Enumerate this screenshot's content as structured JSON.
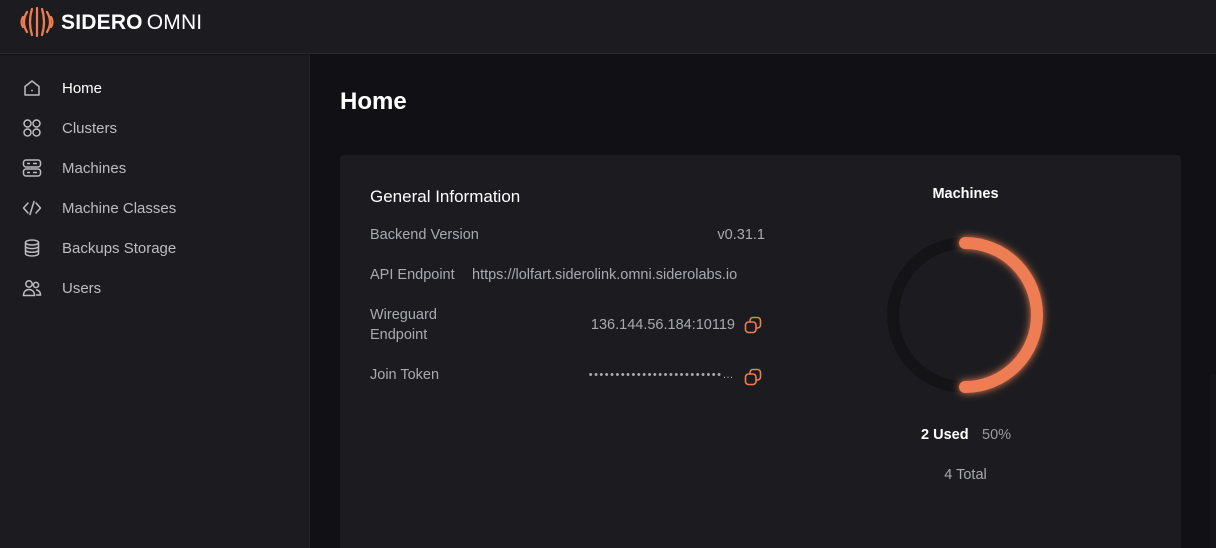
{
  "header": {
    "brand_primary": "SIDERO",
    "brand_secondary": "OMNI",
    "logo_icon": "sidero-logo-icon"
  },
  "sidebar": {
    "items": [
      {
        "label": "Home",
        "icon": "home-icon",
        "active": true
      },
      {
        "label": "Clusters",
        "icon": "grid-icon",
        "active": false
      },
      {
        "label": "Machines",
        "icon": "server-icon",
        "active": false
      },
      {
        "label": "Machine Classes",
        "icon": "code-icon",
        "active": false
      },
      {
        "label": "Backups Storage",
        "icon": "database-icon",
        "active": false
      },
      {
        "label": "Users",
        "icon": "users-icon",
        "active": false
      }
    ]
  },
  "main": {
    "title": "Home",
    "general_info": {
      "title": "General Information",
      "backend_version_label": "Backend Version",
      "backend_version": "v0.31.1",
      "api_endpoint_label": "API Endpoint",
      "api_endpoint": "https://lolfart.siderolink.omni.siderolabs.io",
      "wireguard_label_line1": "Wireguard",
      "wireguard_label_line2": "Endpoint",
      "wireguard_endpoint": "136.144.56.184:10119",
      "join_token_label": "Join Token",
      "join_token_masked": "•••••••••••••••••••••••••…"
    },
    "machines": {
      "title": "Machines",
      "used": "2 Used",
      "percent": "50%",
      "total": "4 Total",
      "used_fraction": 0.5
    }
  },
  "colors": {
    "accent": "#ee7d52",
    "background": "#111115",
    "panel": "#1c1c20",
    "donut_track": "#141417"
  }
}
